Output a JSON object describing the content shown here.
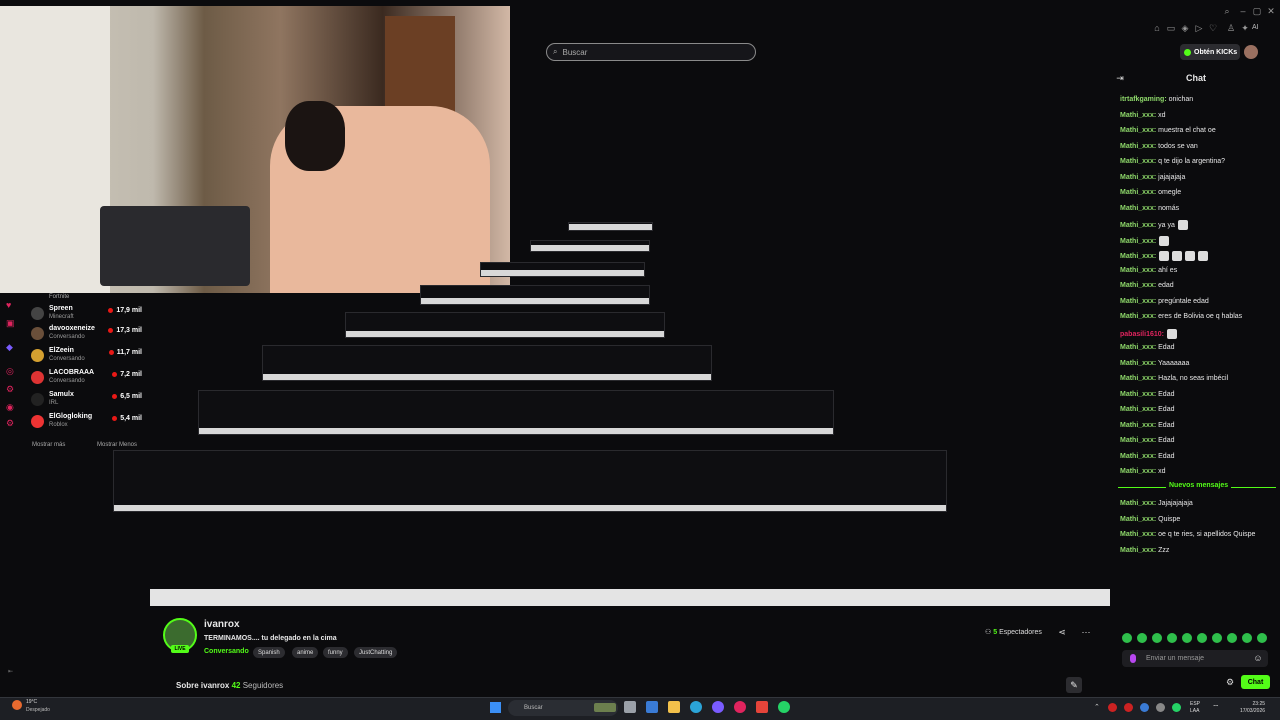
{
  "browser": {
    "search_placeholder": "Buscar",
    "kick_button": "Obtén KICKs",
    "ai_label": "AI"
  },
  "sidebar": {
    "top_category": "Fortnite",
    "channels": [
      {
        "name": "Spreen",
        "sub": "Minecraft",
        "viewers": "17,9 mil"
      },
      {
        "name": "davooxeneize",
        "sub": "Conversando",
        "viewers": "17,3 mil"
      },
      {
        "name": "ElZeein",
        "sub": "Conversando",
        "viewers": "11,7 mil"
      },
      {
        "name": "LACOBRAAA",
        "sub": "Conversando",
        "viewers": "7,2 mil"
      },
      {
        "name": "Samulx",
        "sub": "IRL",
        "viewers": "6,5 mil"
      },
      {
        "name": "ElGlogloking",
        "sub": "Roblox",
        "viewers": "5,4 mil"
      }
    ],
    "show_more": "Mostrar más",
    "show_less": "Mostrar Menos"
  },
  "chat": {
    "title": "Chat",
    "messages": [
      {
        "user": "itrtafkgaming:",
        "text": " onichan"
      },
      {
        "user": "Mathi_xxx:",
        "text": " xd"
      },
      {
        "user": "Mathi_xxx:",
        "text": " muestra el chat oe"
      },
      {
        "user": "Mathi_xxx:",
        "text": " todos se van"
      },
      {
        "user": "Mathi_xxx:",
        "text": " q te dijo la argentina?"
      },
      {
        "user": "Mathi_xxx:",
        "text": " jajajajaja"
      },
      {
        "user": "Mathi_xxx:",
        "text": " omegle"
      },
      {
        "user": "Mathi_xxx:",
        "text": " nomás"
      },
      {
        "user": "Mathi_xxx:",
        "text": " ya ya"
      },
      {
        "user": "Mathi_xxx:",
        "text": ""
      },
      {
        "user": "Mathi_xxx:",
        "text": ""
      },
      {
        "user": "Mathi_xxx:",
        "text": " ahí es"
      },
      {
        "user": "Mathi_xxx:",
        "text": " edad"
      },
      {
        "user": "Mathi_xxx:",
        "text": " pregúntale edad"
      },
      {
        "user": "Mathi_xxx:",
        "text": " eres de Bolivia oe q hablas"
      },
      {
        "user": "pabasili1610:",
        "text": ""
      },
      {
        "user": "Mathi_xxx:",
        "text": " Edad"
      },
      {
        "user": "Mathi_xxx:",
        "text": " Yaaaaaaa"
      },
      {
        "user": "Mathi_xxx:",
        "text": " Hazla, no seas imbécil"
      },
      {
        "user": "Mathi_xxx:",
        "text": " Edad"
      },
      {
        "user": "Mathi_xxx:",
        "text": " Edad"
      },
      {
        "user": "Mathi_xxx:",
        "text": " Edad"
      },
      {
        "user": "Mathi_xxx:",
        "text": " Edad"
      },
      {
        "user": "Mathi_xxx:",
        "text": " Edad"
      },
      {
        "user": "Mathi_xxx:",
        "text": " xd"
      }
    ],
    "new_messages_label": "Nuevos mensajes",
    "new_messages": [
      {
        "user": "Mathi_xxx:",
        "text": " Jajajajajaja"
      },
      {
        "user": "Mathi_xxx:",
        "text": " Quispe"
      },
      {
        "user": "Mathi_xxx:",
        "text": " oe q te ries, si apellidos Quispe"
      },
      {
        "user": "Mathi_xxx:",
        "text": " Zzz"
      }
    ],
    "input_placeholder": "Enviar un mensaje",
    "send_button": "Chat"
  },
  "stream": {
    "streamer": "ivanrox",
    "live_badge": "LIVE",
    "title": "TERMINAMOS.... tu delegado en la cima",
    "category": "Conversando",
    "tags": [
      "Spanish",
      "anime",
      "funny",
      "JustChatting"
    ],
    "viewers_count": "5",
    "viewers_label": " Espectadores",
    "about_label": "Sobre ivanrox ",
    "followers_count": "42",
    "followers_label": " Seguidores"
  },
  "taskbar": {
    "temp": "19°C",
    "condition": "Despejado",
    "search": "Buscar",
    "lang1": "ESP",
    "lang2": "LAA",
    "time": "23:25",
    "date": "17/03/2026"
  },
  "colors": {
    "accent": "#53fc18",
    "live_red": "#e91916",
    "background": "#0b0b0d"
  }
}
